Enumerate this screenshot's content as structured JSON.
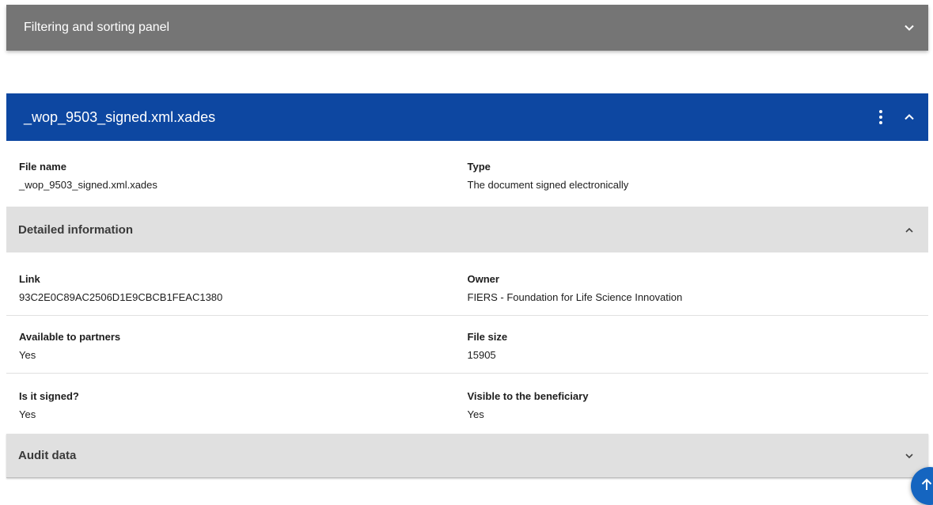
{
  "filter_panel": {
    "title": "Filtering and sorting panel",
    "toggle_icon": "chevron-down-icon"
  },
  "file_card": {
    "title": "_wop_9503_signed.xml.xades",
    "menu_icon": "more-vertical-icon",
    "collapse_icon": "chevron-up-icon",
    "basic": {
      "file_name_label": "File name",
      "file_name_value": "_wop_9503_signed.xml.xades",
      "type_label": "Type",
      "type_value": "The document signed electronically"
    },
    "detailed": {
      "title": "Detailed information",
      "toggle_icon": "chevron-up-icon",
      "link_label": "Link",
      "link_value": "93C2E0C89AC2506D1E9CBCB1FEAC1380",
      "owner_label": "Owner",
      "owner_value": "FIERS - Foundation for Life Science Innovation",
      "available_label": "Available to partners",
      "available_value": "Yes",
      "size_label": "File size",
      "size_value": "15905",
      "signed_label": "Is it signed?",
      "signed_value": "Yes",
      "visible_label": "Visible to the beneficiary",
      "visible_value": "Yes"
    },
    "audit": {
      "title": "Audit data",
      "toggle_icon": "chevron-down-icon"
    }
  },
  "scroll_top_icon": "arrow-up-icon",
  "colors": {
    "filter_bg": "#757575",
    "header_bg": "#0d47a1",
    "section_bg": "#e0e0e0",
    "fab_bg": "#1565c0"
  }
}
